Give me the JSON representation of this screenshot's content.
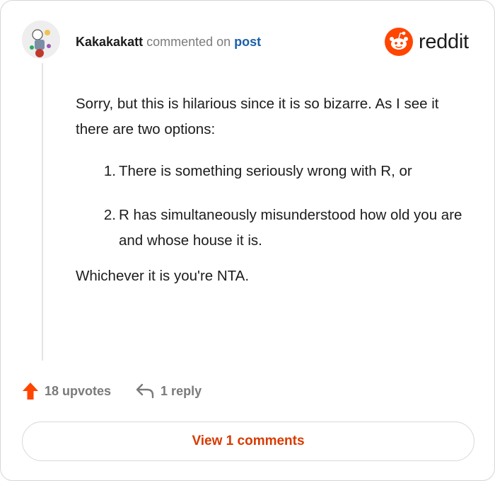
{
  "comment": {
    "username": "Kakakakatt",
    "action_text": "commented on",
    "post_link": "post",
    "body": {
      "intro": "Sorry, but this is hilarious since it is so bizarre. As I see it there are two options:",
      "options": [
        {
          "number": "1.",
          "text": "There is something seriously wrong with R, or"
        },
        {
          "number": "2.",
          "text": "R has simultaneously misunderstood how old you are and whose house it is."
        }
      ],
      "conclusion": "Whichever it is you're NTA."
    }
  },
  "brand": {
    "name": "reddit",
    "icon": "reddit-snoo-icon",
    "color": "#ff4500"
  },
  "footer": {
    "upvotes_label": "18 upvotes",
    "upvote_icon": "upvote-arrow-icon",
    "upvote_color": "#ff4500",
    "reply_label": "1 reply",
    "reply_icon": "reply-arrow-icon"
  },
  "view_comments_label": "View 1 comments"
}
